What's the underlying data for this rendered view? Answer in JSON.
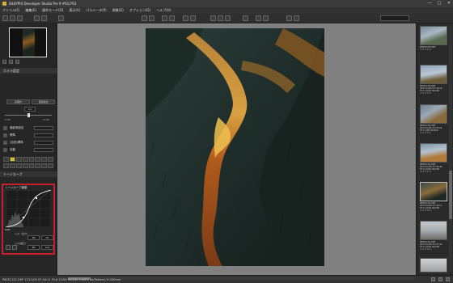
{
  "window": {
    "title": "SILKYPIX Developer Studio Pro 9  #61/763",
    "minimize": "—",
    "maximize": "□",
    "close": "✕"
  },
  "menu": [
    "ファイル(F)",
    "編集(E)",
    "操作モード(O)",
    "表示(V)",
    "パラメータ(P)",
    "現像(D)",
    "オプション(O)",
    "ヘルプ(H)"
  ],
  "left_panel": {
    "parameters_header": "カメラ設定",
    "sub_tabs": [
      "初期化",
      "自動露出"
    ],
    "exposure_value": "0.0",
    "slider_min": "-2.00",
    "slider_max": "+2.00",
    "tools": [
      {
        "label": "撮影時設定"
      },
      {
        "label": "標準"
      },
      {
        "label": "(自然)標準"
      },
      {
        "label": "自動"
      }
    ],
    "curve_section_header": "トーンカーブ",
    "curve_box_header": "トーンカーブ編集",
    "curve_rgb_label": "RGB",
    "input_label": "入力（出力）",
    "input_values": [
      "49",
      "61"
    ],
    "output_label": "入力(補正)",
    "output_values": [
      "89",
      "110"
    ]
  },
  "filmstrip": [
    {
      "name": "P8051134.ORF",
      "date": "2017/11/05 07:34:11",
      "exif": "F3.5 1/100 ISO200",
      "stars": "★★★★★"
    },
    {
      "name": "P8051135.ORF",
      "date": "2017/11/05 07:34:18",
      "exif": "F3.5 1/100 ISO200",
      "stars": "★★★★★"
    },
    {
      "name": "P8051136.ORF",
      "date": "2017/11/05 07:35:01",
      "exif": "F3.5 1/80 ISO200",
      "stars": "★★★★★"
    },
    {
      "name": "P8051122.ORF",
      "date": "2017/11/05 07:36:46",
      "exif": "F5.6 1/200 ISO200",
      "stars": "★★★★★"
    },
    {
      "name": "P8051123.ORF",
      "date": "2017/11/05 07:34:11",
      "exif": "F3.5 1/100 ISO200",
      "stars": "★★★★★"
    },
    {
      "name": "P8051124.ORF",
      "date": "2017/11/05 07:37:32",
      "exif": "F3.5 1/100 ISO200",
      "stars": "★★★★★"
    }
  ],
  "status": {
    "text": "P8051122.ORF  17/11/05 07:34:11  F5.6  1/100 ISO200  0.00EV  Av(Pattern)  f=100mm"
  },
  "colors": {
    "highlight_box": "#c8202a",
    "active_tool": "#d9c020",
    "canvas_bg": "#808080"
  }
}
